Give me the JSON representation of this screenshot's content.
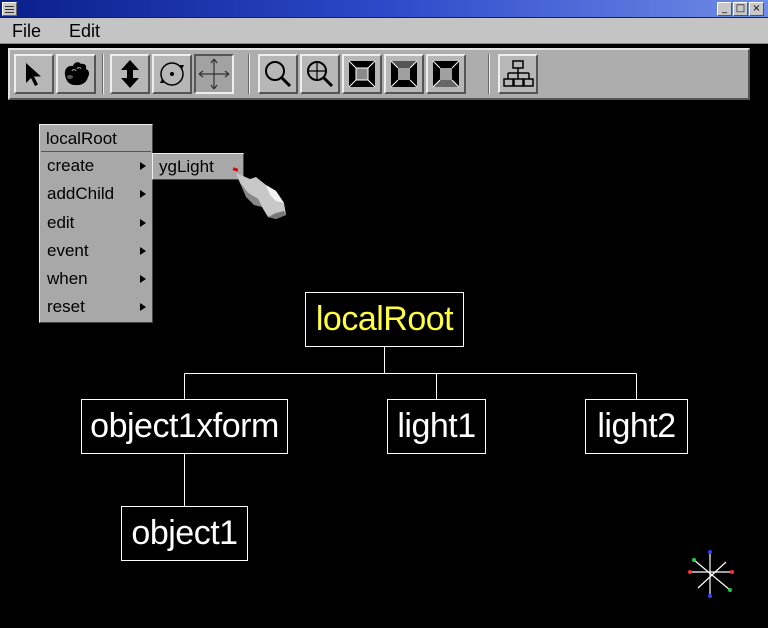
{
  "window": {
    "buttons": {
      "minimize": "_",
      "maximize": "□",
      "close": "×"
    }
  },
  "menubar": {
    "items": [
      {
        "label": "File"
      },
      {
        "label": "Edit"
      }
    ]
  },
  "toolbar": {
    "tools": [
      {
        "name": "select-tool",
        "icon": "arrow-pointer-icon"
      },
      {
        "name": "grab-tool",
        "icon": "grab-hand-icon"
      },
      {
        "name": "translate-vertical-tool",
        "icon": "vertical-arrows-icon"
      },
      {
        "name": "rotate-tool",
        "icon": "rotate-icon"
      },
      {
        "name": "translate-tool",
        "icon": "move-cross-icon",
        "pressed": true
      },
      {
        "name": "zoom-tool",
        "icon": "magnifier-icon"
      },
      {
        "name": "zoom-in-tool",
        "icon": "magnifier-plus-icon"
      },
      {
        "name": "view-front-tool",
        "icon": "view-box-dark-icon"
      },
      {
        "name": "view-perspective-tool",
        "icon": "view-box-icon"
      },
      {
        "name": "view-side-tool",
        "icon": "view-box-side-icon"
      },
      {
        "name": "scene-graph-tool",
        "icon": "tree-hierarchy-icon"
      }
    ]
  },
  "context_menu": {
    "title": "localRoot",
    "items": [
      {
        "label": "create",
        "has_submenu": true
      },
      {
        "label": "addChild",
        "has_submenu": true
      },
      {
        "label": "edit",
        "has_submenu": true
      },
      {
        "label": "event",
        "has_submenu": true
      },
      {
        "label": "when",
        "has_submenu": true
      },
      {
        "label": "reset",
        "has_submenu": true
      }
    ],
    "submenu": {
      "items": [
        {
          "label": "ygLight"
        }
      ]
    }
  },
  "scene_graph": {
    "root": {
      "label": "localRoot",
      "color": "#ffff40"
    },
    "children": [
      {
        "label": "object1xform"
      },
      {
        "label": "light1"
      },
      {
        "label": "light2"
      }
    ],
    "grandchildren": [
      {
        "label": "object1"
      }
    ]
  },
  "colors": {
    "background": "#000000",
    "node_text": "#ffffff",
    "root_text": "#ffff40",
    "panel": "#adadad"
  }
}
